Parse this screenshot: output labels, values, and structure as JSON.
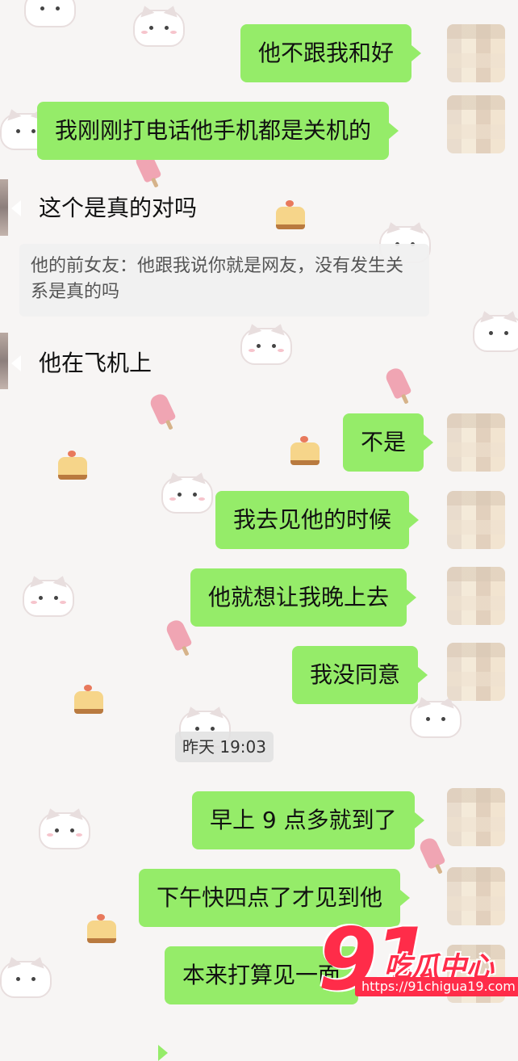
{
  "messages": [
    {
      "side": "right",
      "text": "他不跟我和好"
    },
    {
      "side": "right",
      "text": "我刚刚打电话他手机都是关机的"
    },
    {
      "side": "left",
      "text": "这个是真的对吗"
    },
    {
      "side": "left",
      "text": "他在飞机上"
    },
    {
      "side": "right",
      "text": "不是"
    },
    {
      "side": "right",
      "text": "我去见他的时候"
    },
    {
      "side": "right",
      "text": "他就想让我晚上去"
    },
    {
      "side": "right",
      "text": "我没同意"
    },
    {
      "side": "right",
      "text": "早上 9 点多就到了"
    },
    {
      "side": "right",
      "text": "下午快四点了才见到他"
    },
    {
      "side": "right",
      "text": "本来打算见一面"
    }
  ],
  "quote": {
    "text": "他的前女友：他跟我说你就是网友，没有发生关系是真的吗"
  },
  "timestamp": "昨天 19:03",
  "watermark": {
    "number": "91",
    "name": "吃瓜中心",
    "url": "https://91chigua19.com"
  },
  "colors": {
    "sent_bubble": "#95ec69",
    "received_bubble": "#ffffff",
    "watermark": "#ff2c49"
  }
}
